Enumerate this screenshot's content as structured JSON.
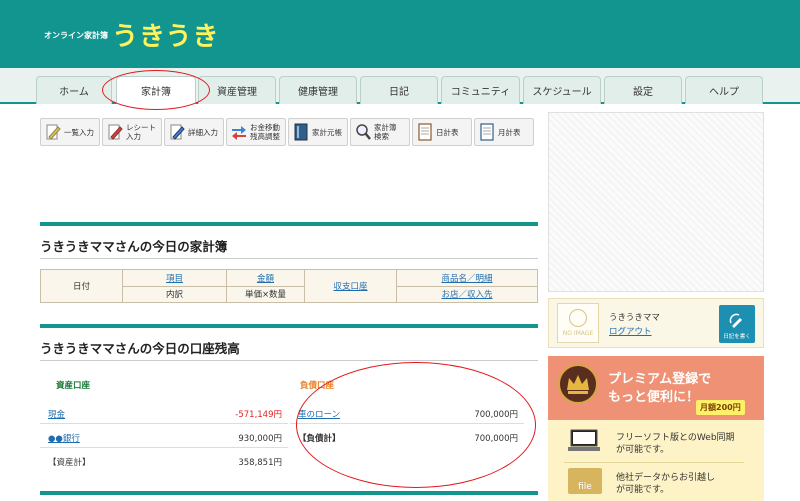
{
  "header": {
    "logo_small": "オンライン家計簿",
    "logo_big": "うきうき",
    "bg_color": "#12948f",
    "logo_color": "#fff25a"
  },
  "tabs": [
    {
      "label": "ホーム",
      "active": false
    },
    {
      "label": "家計簿",
      "active": true
    },
    {
      "label": "資産管理",
      "active": false
    },
    {
      "label": "健康管理",
      "active": false
    },
    {
      "label": "日記",
      "active": false
    },
    {
      "label": "コミュニティ",
      "active": false
    },
    {
      "label": "スケジュール",
      "active": false
    },
    {
      "label": "設定",
      "active": false
    },
    {
      "label": "ヘルプ",
      "active": false
    }
  ],
  "toolbar": [
    {
      "label": "一覧入力",
      "icon": "pencil-icon"
    },
    {
      "label": "レシート入力",
      "icon": "receipt-pencil-icon"
    },
    {
      "label": "詳細入力",
      "icon": "detail-pencil-icon"
    },
    {
      "label1": "お金移動",
      "label2": "残高調整",
      "icon": "transfer-arrows-icon"
    },
    {
      "label": "家計元帳",
      "icon": "ledger-book-icon"
    },
    {
      "label1": "家計簿",
      "label2": "検索",
      "icon": "magnifier-icon"
    },
    {
      "label": "日計表",
      "icon": "daily-sheet-icon"
    },
    {
      "label": "月計表",
      "icon": "monthly-sheet-icon"
    }
  ],
  "kakeibo": {
    "title": "うきうきママさんの今日の家計簿",
    "col_date": "日付",
    "col_item": "項目",
    "col_detail": "内訳",
    "col_amount": "金額",
    "col_unit": "単価×数量",
    "col_account": "収支口座",
    "col_product": "商品名／明細",
    "col_shop": "お店／収入先"
  },
  "balance": {
    "title": "うきうきママさんの今日の口座残高",
    "assets_header": "資産口座",
    "assets": [
      {
        "name": "現金",
        "amount": "-571,149円"
      },
      {
        "name": "●●銀行",
        "amount": "930,000円"
      }
    ],
    "assets_total_label": "【資産計】",
    "assets_total": "358,851円",
    "debts_header": "負債口座",
    "debts": [
      {
        "name": "車のローン",
        "amount": "700,000円"
      }
    ],
    "debts_total_label": "【負債計】",
    "debts_total": "700,000円"
  },
  "user": {
    "noimage": "NO IMAGE",
    "name": "うきうきママ",
    "logout": "ログアウト",
    "diary_button": "日記を書く"
  },
  "premium": {
    "line1": "プレミアム登録で",
    "line2": "もっと便利に！",
    "price": "月額200円",
    "feature1_line1": "フリーソフト版とのWeb同期",
    "feature1_line2": "が可能です。",
    "feature2_icon_label": "file",
    "feature2_line1": "他社データからお引越し",
    "feature2_line2": "が可能です。"
  },
  "colors": {
    "accent": "#12948f",
    "annotation_red": "#e0191f",
    "link": "#1f6fb0",
    "negative": "#e02020",
    "debt_header": "#e8822a",
    "asset_header": "#1a7a3a"
  }
}
